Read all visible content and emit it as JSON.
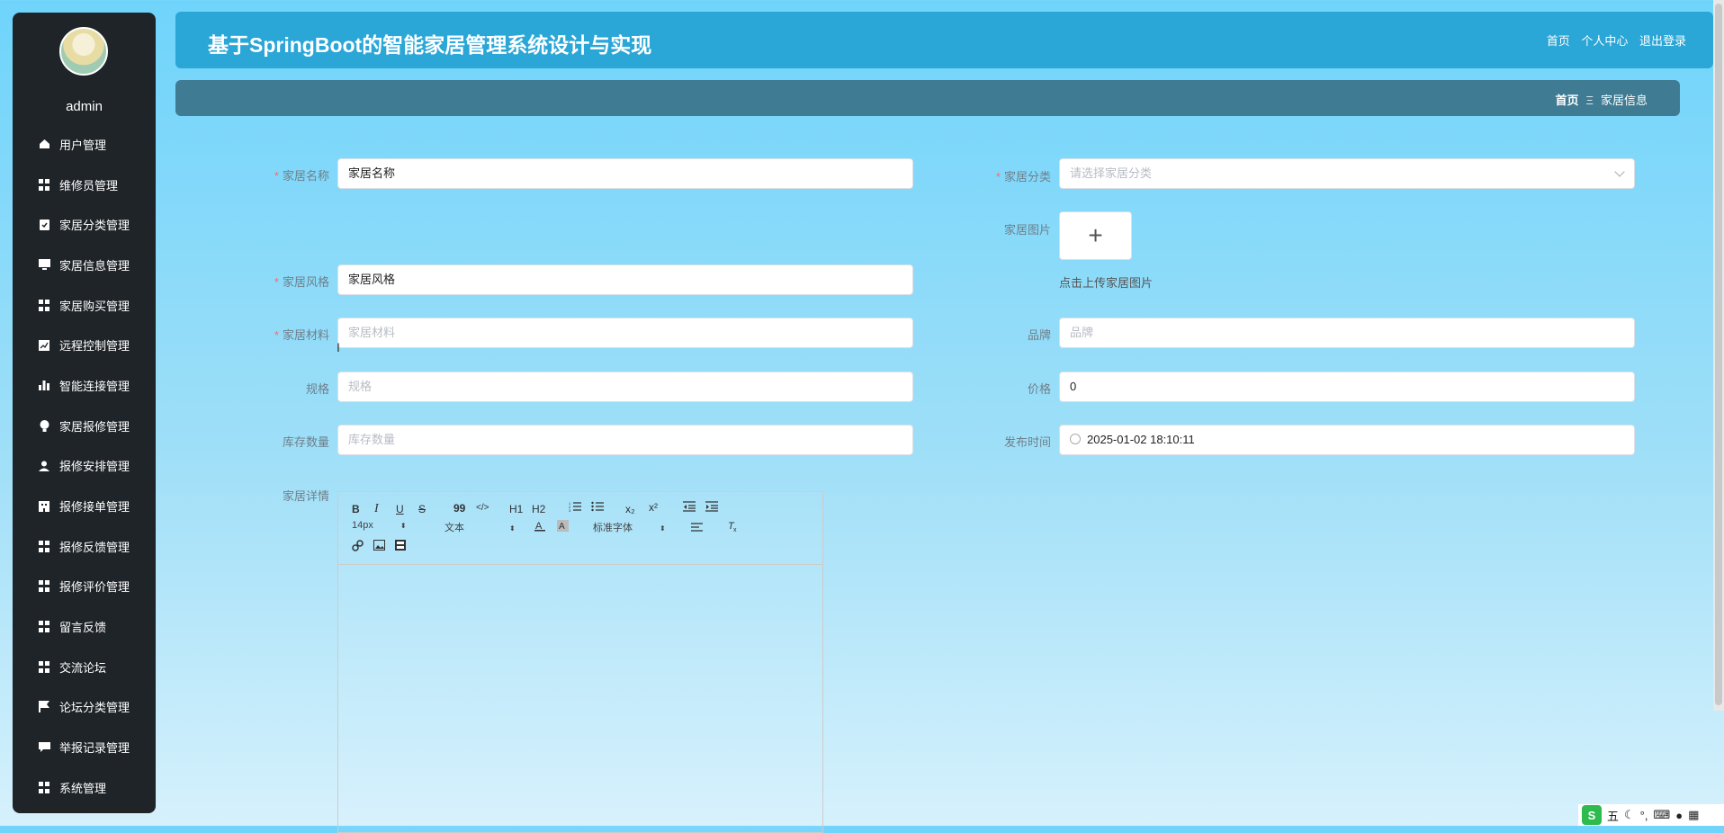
{
  "sidebar": {
    "username": "admin",
    "items": [
      {
        "label": "用户管理",
        "icon": "home-icon"
      },
      {
        "label": "维修员管理",
        "icon": "grid-icon"
      },
      {
        "label": "家居分类管理",
        "icon": "clipboard-icon"
      },
      {
        "label": "家居信息管理",
        "icon": "monitor-icon"
      },
      {
        "label": "家居购买管理",
        "icon": "grid-icon"
      },
      {
        "label": "远程控制管理",
        "icon": "chart-icon"
      },
      {
        "label": "智能连接管理",
        "icon": "bar-chart-icon"
      },
      {
        "label": "家居报修管理",
        "icon": "bulb-icon"
      },
      {
        "label": "报修安排管理",
        "icon": "user-icon"
      },
      {
        "label": "报修接单管理",
        "icon": "building-icon"
      },
      {
        "label": "报修反馈管理",
        "icon": "grid-icon"
      },
      {
        "label": "报修评价管理",
        "icon": "grid-icon"
      },
      {
        "label": "留言反馈",
        "icon": "grid-icon"
      },
      {
        "label": "交流论坛",
        "icon": "grid-icon"
      },
      {
        "label": "论坛分类管理",
        "icon": "flag-icon"
      },
      {
        "label": "举报记录管理",
        "icon": "chat-icon"
      },
      {
        "label": "系统管理",
        "icon": "grid-icon"
      }
    ]
  },
  "header": {
    "title": "基于SpringBoot的智能家居管理系统设计与实现",
    "links": [
      "首页",
      "个人中心",
      "退出登录"
    ]
  },
  "breadcrumb": {
    "home": "首页",
    "sep": "Ξ",
    "current": "家居信息"
  },
  "form": {
    "name_label": "家居名称",
    "name_value": "家居名称",
    "category_label": "家居分类",
    "category_placeholder": "请选择家居分类",
    "image_label": "家居图片",
    "upload_tip": "点击上传家居图片",
    "upload_plus": "+",
    "style_label": "家居风格",
    "style_value": "家居风格",
    "material_label": "家居材料",
    "material_placeholder": "家居材料",
    "brand_label": "品牌",
    "brand_placeholder": "品牌",
    "spec_label": "规格",
    "spec_placeholder": "规格",
    "price_label": "价格",
    "price_value": "0",
    "stock_label": "库存数量",
    "stock_placeholder": "库存数量",
    "publish_label": "发布时间",
    "publish_value": "2025-01-02 18:10:11",
    "detail_label": "家居详情",
    "required_mark": "*"
  },
  "editor": {
    "tools": [
      "B",
      "I",
      "U",
      "S",
      "99",
      "</>",
      "H1",
      "H2",
      "ol",
      "ul",
      "x₂",
      "x²",
      "indent-left",
      "indent-right"
    ],
    "font_size": "14px",
    "text_type": "文本",
    "font_family": "标准字体"
  },
  "tray": {
    "ime": "S",
    "ime_mode": "五"
  }
}
